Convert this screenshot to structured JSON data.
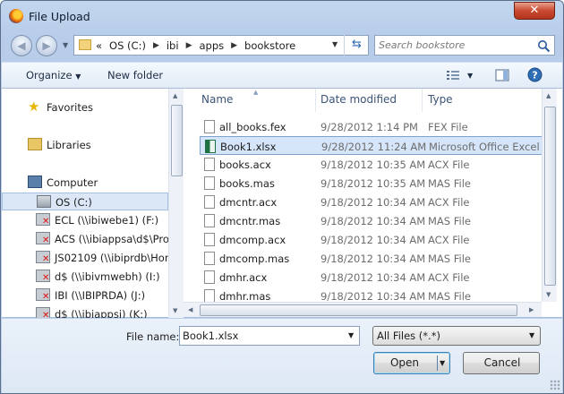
{
  "window": {
    "title": "File Upload",
    "close_label": "✕"
  },
  "address": {
    "crumbs": [
      "«",
      "OS (C:)",
      "ibi",
      "apps",
      "bookstore"
    ],
    "search_placeholder": "Search bookstore"
  },
  "toolbar": {
    "organize": "Organize",
    "new_folder": "New folder"
  },
  "nav": {
    "favorites": "Favorites",
    "libraries": "Libraries",
    "computer": "Computer",
    "drives": [
      {
        "label": "OS (C:)",
        "selected": true,
        "icon": "local-drive-icon"
      },
      {
        "label": "ECL (\\\\ibiwebe1) (F:)",
        "icon": "network-drive-disconnected-icon"
      },
      {
        "label": "ACS (\\\\ibiappsa\\d$\\Pro",
        "icon": "network-drive-disconnected-icon"
      },
      {
        "label": "JS02109 (\\\\ibiprdb\\Hom",
        "icon": "network-drive-disconnected-icon"
      },
      {
        "label": "d$ (\\\\ibivmwebh) (I:)",
        "icon": "network-drive-disconnected-icon"
      },
      {
        "label": "IBI (\\\\IBIPRDA) (J:)",
        "icon": "network-drive-disconnected-icon"
      },
      {
        "label": "d$ (\\\\ibiappsi) (K:)",
        "icon": "network-drive-disconnected-icon"
      }
    ]
  },
  "columns": {
    "name": "Name",
    "date": "Date modified",
    "type": "Type"
  },
  "files": [
    {
      "name": "all_books.fex",
      "date": "9/28/2012 1:14 PM",
      "type": "FEX File",
      "icon": "document-icon"
    },
    {
      "name": "Book1.xlsx",
      "date": "9/28/2012 11:24 AM",
      "type": "Microsoft Office Excel ...",
      "icon": "excel-icon",
      "selected": true
    },
    {
      "name": "books.acx",
      "date": "9/18/2012 10:35 AM",
      "type": "ACX File",
      "icon": "document-icon"
    },
    {
      "name": "books.mas",
      "date": "9/18/2012 10:35 AM",
      "type": "MAS File",
      "icon": "document-icon"
    },
    {
      "name": "dmcntr.acx",
      "date": "9/18/2012 10:34 AM",
      "type": "ACX File",
      "icon": "document-icon"
    },
    {
      "name": "dmcntr.mas",
      "date": "9/18/2012 10:34 AM",
      "type": "MAS File",
      "icon": "document-icon"
    },
    {
      "name": "dmcomp.acx",
      "date": "9/18/2012 10:34 AM",
      "type": "ACX File",
      "icon": "document-icon"
    },
    {
      "name": "dmcomp.mas",
      "date": "9/18/2012 10:34 AM",
      "type": "MAS File",
      "icon": "document-icon"
    },
    {
      "name": "dmhr.acx",
      "date": "9/18/2012 10:34 AM",
      "type": "ACX File",
      "icon": "document-icon"
    },
    {
      "name": "dmhr.mas",
      "date": "9/18/2012 10:34 AM",
      "type": "MAS File",
      "icon": "document-icon"
    }
  ],
  "bottom": {
    "file_name_label": "File name:",
    "file_name_value": "Book1.xlsx",
    "file_type": "All Files (*.*)",
    "open": "Open",
    "cancel": "Cancel"
  },
  "colors": {
    "selection": "#d5e5fa",
    "accent": "#3c7fb1",
    "close": "#c94a30"
  }
}
